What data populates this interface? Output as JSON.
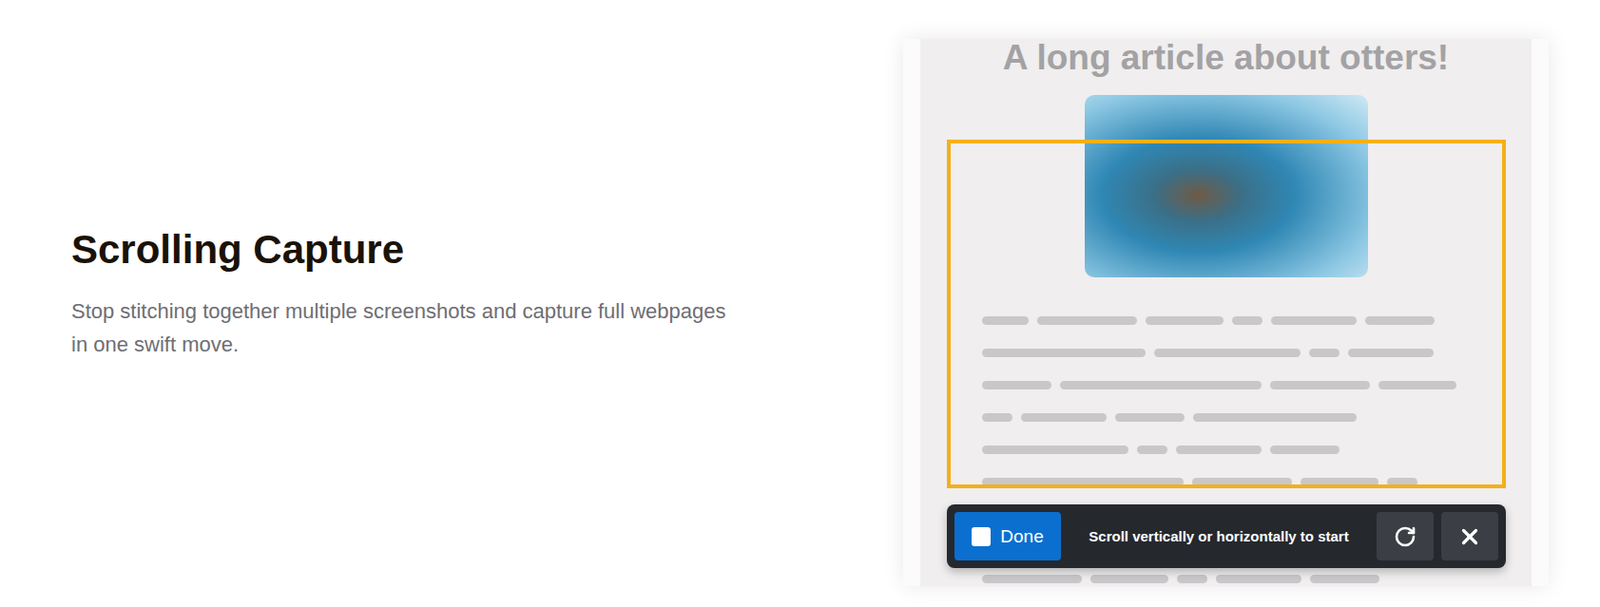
{
  "feature": {
    "title": "Scrolling Capture",
    "description": "Stop stitching together multiple screenshots and capture full webpages in one swift move."
  },
  "preview": {
    "article_title": "A long article about otters!",
    "toolbar": {
      "done": {
        "label": "Done",
        "checked": false
      },
      "hint": "Scroll vertically or horizontally to start"
    }
  }
}
